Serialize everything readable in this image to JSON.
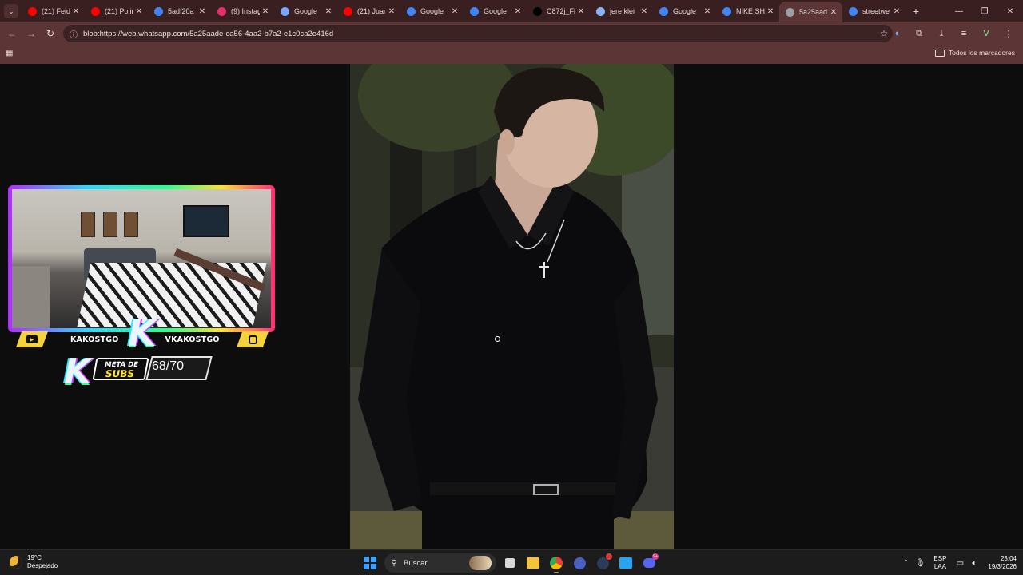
{
  "browser": {
    "tabs": [
      {
        "title": "(21) Feid",
        "favicon": "youtube-icon",
        "color": "#ff0000"
      },
      {
        "title": "(21) Polin",
        "favicon": "youtube-icon",
        "color": "#ff0000"
      },
      {
        "title": "5adf20a",
        "favicon": "google-icon",
        "color": "#4285f4"
      },
      {
        "title": "(9) Instag",
        "favicon": "instagram-icon",
        "color": "#e1306c"
      },
      {
        "title": "Google",
        "favicon": "gemini-icon",
        "color": "#7aa7ff"
      },
      {
        "title": "(21) Juan",
        "favicon": "youtube-icon",
        "color": "#ff0000"
      },
      {
        "title": "Google",
        "favicon": "google-icon",
        "color": "#4285f4"
      },
      {
        "title": "Google",
        "favicon": "google-icon",
        "color": "#4285f4"
      },
      {
        "title": "C872j_Fi",
        "favicon": "x-icon",
        "color": "#000000"
      },
      {
        "title": "jere klei",
        "favicon": "search-icon",
        "color": "#8ab4f8"
      },
      {
        "title": "Google",
        "favicon": "google-icon",
        "color": "#4285f4"
      },
      {
        "title": "NIKE SH",
        "favicon": "google-icon",
        "color": "#4285f4"
      },
      {
        "title": "5a25aad",
        "favicon": "globe-icon",
        "color": "#9aa0a6",
        "active": true
      },
      {
        "title": "streetwe",
        "favicon": "google-icon",
        "color": "#4285f4"
      }
    ],
    "new_tab_label": "+",
    "url": "blob:https://web.whatsapp.com/5a25aade-ca56-4aa2-b7a2-e1c0ca2e416d",
    "bookmarks_all_label": "Todos los marcadores",
    "accent": "#5c3536"
  },
  "overlay": {
    "left_name": "KAKOSTGO",
    "right_name": "VKAKOSTGO",
    "logo_letter": "K",
    "meta_line1": "META DE",
    "meta_line2": "SUBS",
    "sub_count": "68/70"
  },
  "taskbar": {
    "temperature": "19°C",
    "weather": "Despejado",
    "search_placeholder": "Buscar",
    "lang_line1": "ESP",
    "lang_line2": "LAA",
    "time": "23:04",
    "date": "19/3/2026",
    "discord_badge": "9+"
  }
}
